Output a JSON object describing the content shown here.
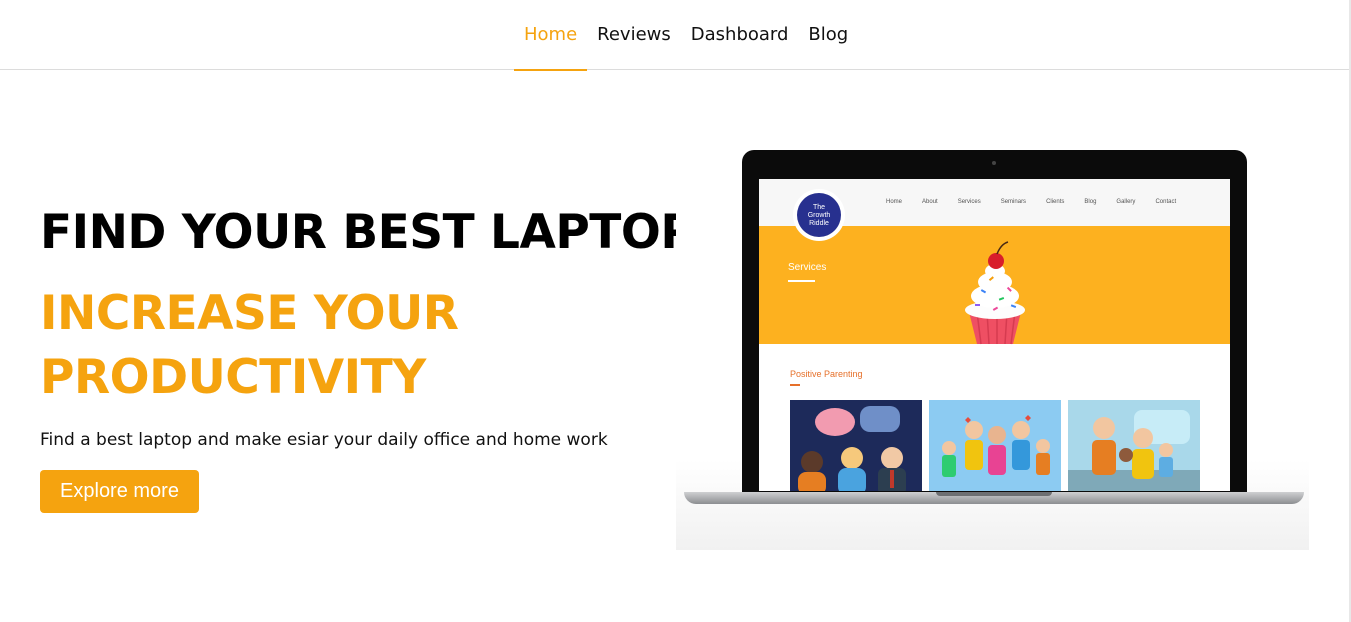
{
  "nav": {
    "items": [
      {
        "label": "Home",
        "active": true
      },
      {
        "label": "Reviews",
        "active": false
      },
      {
        "label": "Dashboard",
        "active": false
      },
      {
        "label": "Blog",
        "active": false
      }
    ]
  },
  "hero": {
    "title": "FIND YOUR BEST LAPTOP",
    "subtitle_line1": "INCREASE YOUR",
    "subtitle_line2": "PRODUCTIVITY",
    "description": "Find a best laptop and make esiar your daily office and home work",
    "cta_label": "Explore more"
  },
  "laptop_screen": {
    "logo_line1": "The",
    "logo_line2": "Growth",
    "logo_line3": "Riddle",
    "nav": [
      "Home",
      "About",
      "Services",
      "Seminars",
      "Clients",
      "Blog",
      "Gallery",
      "Contact"
    ],
    "banner_title": "Services",
    "section_title": "Positive Parenting"
  },
  "colors": {
    "accent": "#f5a30f",
    "banner": "#fdb11f",
    "logo": "#27308f"
  }
}
